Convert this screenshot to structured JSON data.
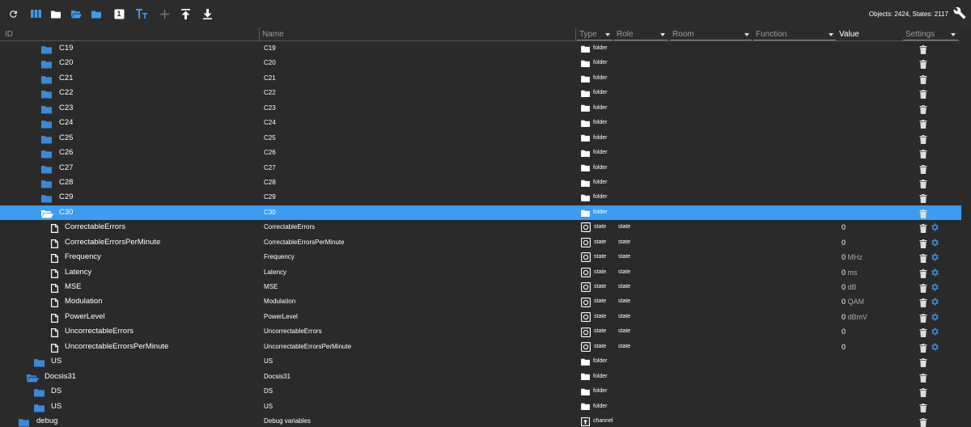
{
  "toolbar": {
    "objects_count": "Objects: 2424, States: 2117",
    "number_badge": "1"
  },
  "header": {
    "id": "ID",
    "name": "Name",
    "type": "Type",
    "role": "Role",
    "room": "Room",
    "function": "Function",
    "value": "Value",
    "settings": "Settings"
  },
  "rows": [
    {
      "kind": "folder",
      "level": 2,
      "id": "C19",
      "name": "C19",
      "type": "folder"
    },
    {
      "kind": "folder",
      "level": 2,
      "id": "C20",
      "name": "C20",
      "type": "folder"
    },
    {
      "kind": "folder",
      "level": 2,
      "id": "C21",
      "name": "C21",
      "type": "folder"
    },
    {
      "kind": "folder",
      "level": 2,
      "id": "C22",
      "name": "C22",
      "type": "folder"
    },
    {
      "kind": "folder",
      "level": 2,
      "id": "C23",
      "name": "C23",
      "type": "folder"
    },
    {
      "kind": "folder",
      "level": 2,
      "id": "C24",
      "name": "C24",
      "type": "folder"
    },
    {
      "kind": "folder",
      "level": 2,
      "id": "C25",
      "name": "C25",
      "type": "folder"
    },
    {
      "kind": "folder",
      "level": 2,
      "id": "C26",
      "name": "C26",
      "type": "folder"
    },
    {
      "kind": "folder",
      "level": 2,
      "id": "C27",
      "name": "C27",
      "type": "folder"
    },
    {
      "kind": "folder",
      "level": 2,
      "id": "C28",
      "name": "C28",
      "type": "folder"
    },
    {
      "kind": "folder",
      "level": 2,
      "id": "C29",
      "name": "C29",
      "type": "folder"
    },
    {
      "kind": "folder-open",
      "level": 2,
      "id": "C30",
      "name": "C30",
      "type": "folder",
      "selected": true
    },
    {
      "kind": "state",
      "level": 3,
      "id": "CorrectableErrors",
      "name": "CorrectableErrors",
      "type": "state",
      "role": "state",
      "value": "0",
      "unit": ""
    },
    {
      "kind": "state",
      "level": 3,
      "id": "CorrectableErrorsPerMinute",
      "name": "CorrectableErrorsPerMinute",
      "type": "state",
      "role": "state",
      "value": "0",
      "unit": ""
    },
    {
      "kind": "state",
      "level": 3,
      "id": "Frequency",
      "name": "Frequency",
      "type": "state",
      "role": "state",
      "value": "0",
      "unit": "MHz"
    },
    {
      "kind": "state",
      "level": 3,
      "id": "Latency",
      "name": "Latency",
      "type": "state",
      "role": "state",
      "value": "0",
      "unit": "ms"
    },
    {
      "kind": "state",
      "level": 3,
      "id": "MSE",
      "name": "MSE",
      "type": "state",
      "role": "state",
      "value": "0",
      "unit": "dB"
    },
    {
      "kind": "state",
      "level": 3,
      "id": "Modulation",
      "name": "Modulation",
      "type": "state",
      "role": "state",
      "value": "0",
      "unit": "QAM"
    },
    {
      "kind": "state",
      "level": 3,
      "id": "PowerLevel",
      "name": "PowerLevel",
      "type": "state",
      "role": "state",
      "value": "0",
      "unit": "dBmV"
    },
    {
      "kind": "state",
      "level": 3,
      "id": "UncorrectableErrors",
      "name": "UncorrectableErrors",
      "type": "state",
      "role": "state",
      "value": "0",
      "unit": ""
    },
    {
      "kind": "state",
      "level": 3,
      "id": "UncorrectableErrorsPerMinute",
      "name": "UncorrectableErrorsPerMinute",
      "type": "state",
      "role": "state",
      "value": "0",
      "unit": ""
    },
    {
      "kind": "folder",
      "level": 1,
      "id": "US",
      "name": "US",
      "type": "folder"
    },
    {
      "kind": "folder-open",
      "level": 0,
      "id": "Docsis31",
      "name": "Docsis31",
      "type": "folder"
    },
    {
      "kind": "folder",
      "level": 1,
      "id": "DS",
      "name": "DS",
      "type": "folder"
    },
    {
      "kind": "folder",
      "level": 1,
      "id": "US",
      "name": "US",
      "type": "folder"
    },
    {
      "kind": "folder",
      "level": -1,
      "id": "debug",
      "name": "Debug variables",
      "type": "channel"
    }
  ],
  "colors": {
    "accent": "#3b9cf0",
    "folder_icon": "#3b8ad8",
    "background": "#2a2a2a"
  }
}
